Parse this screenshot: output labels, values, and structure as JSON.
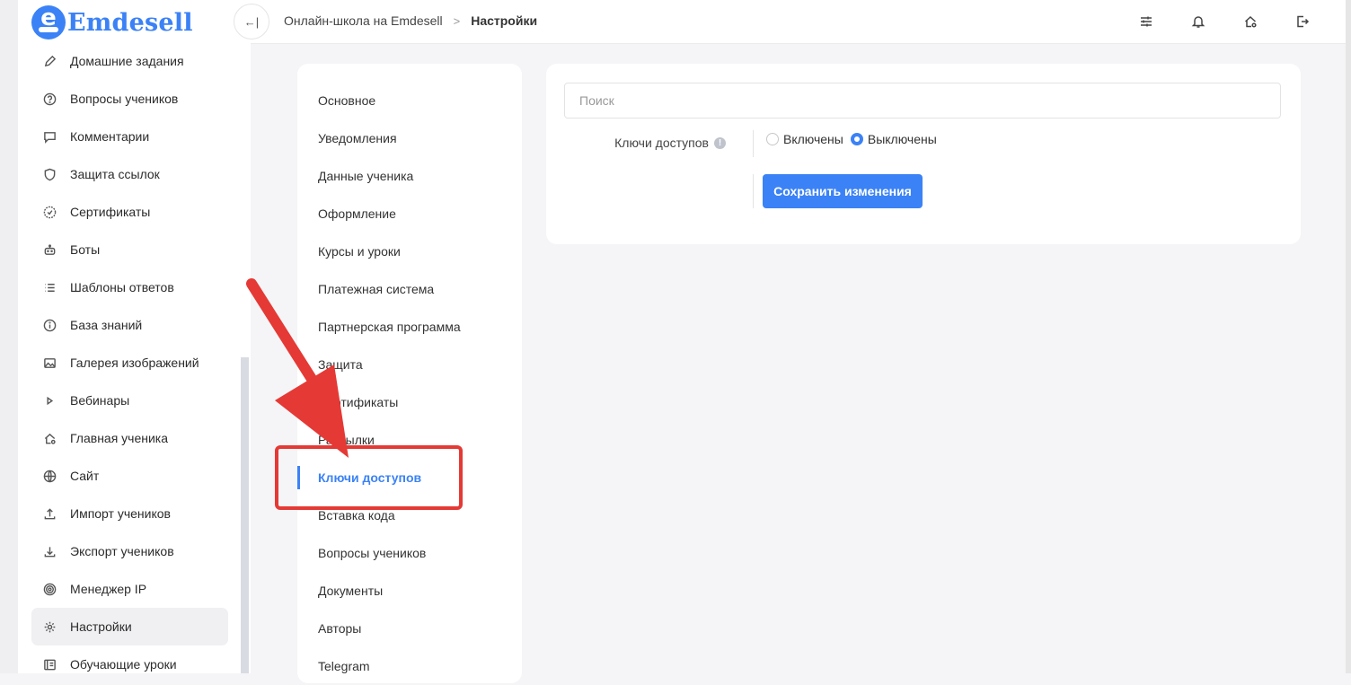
{
  "app": {
    "logo_text": "Emdesell",
    "logo_letter": "e"
  },
  "sidebar": {
    "items": [
      {
        "label": "Домашние задания",
        "icon": "pencil-icon"
      },
      {
        "label": "Вопросы учеников",
        "icon": "question-circle-icon"
      },
      {
        "label": "Комментарии",
        "icon": "comment-icon"
      },
      {
        "label": "Защита ссылок",
        "icon": "shield-icon"
      },
      {
        "label": "Сертификаты",
        "icon": "certificate-icon"
      },
      {
        "label": "Боты",
        "icon": "bot-icon"
      },
      {
        "label": "Шаблоны ответов",
        "icon": "list-icon"
      },
      {
        "label": "База знаний",
        "icon": "info-circle-icon"
      },
      {
        "label": "Галерея изображений",
        "icon": "image-icon"
      },
      {
        "label": "Вебинары",
        "icon": "play-icon"
      },
      {
        "label": "Главная ученика",
        "icon": "home-gear-icon"
      },
      {
        "label": "Сайт",
        "icon": "globe-icon"
      },
      {
        "label": "Импорт учеников",
        "icon": "upload-icon"
      },
      {
        "label": "Экспорт учеников",
        "icon": "download-icon"
      },
      {
        "label": "Менеджер IP",
        "icon": "target-icon"
      },
      {
        "label": "Настройки",
        "icon": "gear-icon",
        "active": true
      },
      {
        "label": "Обучающие уроки",
        "icon": "lessons-icon"
      }
    ]
  },
  "header": {
    "collapse_symbol": "←|",
    "breadcrumb": {
      "school": "Онлайн-школа на Emdesell",
      "separator": ">",
      "current": "Настройки"
    },
    "icons": [
      "sliders-icon",
      "bell-icon",
      "home-gear-icon",
      "logout-icon"
    ]
  },
  "settings_nav": {
    "items": [
      {
        "label": "Основное"
      },
      {
        "label": "Уведомления"
      },
      {
        "label": "Данные ученика"
      },
      {
        "label": "Оформление"
      },
      {
        "label": "Курсы и уроки"
      },
      {
        "label": "Платежная система"
      },
      {
        "label": "Партнерская программа"
      },
      {
        "label": "Защита"
      },
      {
        "label": "Сертификаты"
      },
      {
        "label": "Рассылки"
      },
      {
        "label": "Ключи доступов",
        "active": true
      },
      {
        "label": "Вставка кода"
      },
      {
        "label": "Вопросы учеников"
      },
      {
        "label": "Документы"
      },
      {
        "label": "Авторы"
      },
      {
        "label": "Telegram"
      }
    ]
  },
  "content": {
    "search_placeholder": "Поиск",
    "field_label": "Ключи доступов",
    "info_symbol": "!",
    "options": [
      {
        "label": "Включены",
        "checked": false
      },
      {
        "label": "Выключены",
        "checked": true
      }
    ],
    "save_label": "Сохранить изменения"
  },
  "colors": {
    "accent": "#3b82f6",
    "annotation": "#e53935"
  }
}
